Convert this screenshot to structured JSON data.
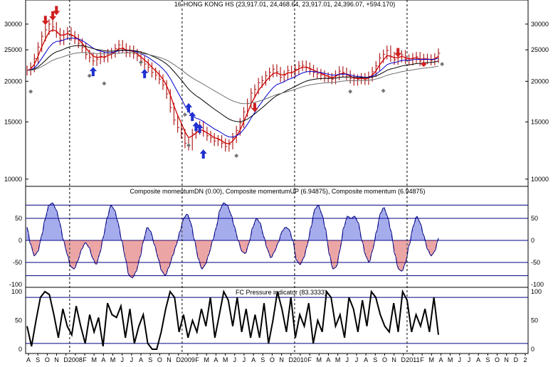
{
  "colors": {
    "up": "#1f2fd0",
    "down": "#d01f1f",
    "price_bar": "#b02020",
    "ma_fast": "#d00000",
    "ma_mid": "#0000d0",
    "ma_slow": "#000000",
    "ma_slowest": "#707070",
    "osc_line": "#000000",
    "band_line": "#000080",
    "grid": "#000000",
    "diamond": "#777777"
  },
  "icons": {
    "buy": "up-arrow-icon",
    "sell": "down-arrow-icon",
    "signal": "diamond-icon"
  },
  "chart_data": [
    {
      "type": "bar",
      "title": "16-HONG KONG HS (23,917.01, 24,468.64, 23,917.01, 24,396.07, +594.170)",
      "ylim": [
        9500,
        33500
      ],
      "scale": "log",
      "y_ticks": [
        "30000",
        "25000",
        "20000",
        "15000",
        "10000"
      ],
      "x_tick_labels": [
        "A",
        "S",
        "O",
        "N",
        "D",
        "2008",
        "F",
        "M",
        "A",
        "M",
        "J",
        "J",
        "A",
        "S",
        "O",
        "N",
        "D",
        "2009",
        "F",
        "M",
        "A",
        "M",
        "J",
        "J",
        "A",
        "S",
        "O",
        "N",
        "D",
        "2010",
        "F",
        "M",
        "A",
        "M",
        "J",
        "J",
        "A",
        "S",
        "O",
        "N",
        "D",
        "2011",
        "F",
        "M",
        "A",
        "M",
        "J",
        "J",
        "A",
        "S",
        "O",
        "N",
        "D",
        "2"
      ],
      "year_boundaries": [
        "2008",
        "2009",
        "2010",
        "2011"
      ],
      "closes": [
        21600,
        22100,
        23500,
        25500,
        27500,
        28800,
        30000,
        29400,
        28200,
        26800,
        27800,
        28400,
        27600,
        27000,
        26200,
        25400,
        24200,
        23700,
        23100,
        23400,
        23900,
        23700,
        24300,
        24500,
        25200,
        25900,
        25300,
        24600,
        24900,
        24300,
        23900,
        23100,
        22600,
        22100,
        21300,
        20900,
        20300,
        19500,
        18300,
        16600,
        15200,
        14400,
        13800,
        12900,
        12700,
        13800,
        14200,
        14600,
        14000,
        13600,
        13400,
        13100,
        13200,
        12900,
        12600,
        12800,
        13400,
        14100,
        14900,
        16100,
        17100,
        18400,
        18900,
        19800,
        20100,
        20800,
        21300,
        21800,
        21400,
        20600,
        20900,
        21600,
        21300,
        21800,
        22300,
        22400,
        22100,
        21700,
        21300,
        21100,
        20900,
        20600,
        20500,
        20300,
        20900,
        21500,
        21300,
        20900,
        20400,
        20100,
        20300,
        20500,
        20200,
        20700,
        21400,
        22300,
        23600,
        24200,
        24900,
        23800,
        23300,
        23700,
        24100,
        23400,
        23200,
        23600,
        23800,
        23100,
        23500,
        23400,
        23200,
        23600,
        24396
      ],
      "moving_averages": [
        "fast",
        "mid",
        "slow",
        "slowest"
      ],
      "sell_signals": [
        {
          "index": 5,
          "value": 30400
        },
        {
          "index": 7,
          "value": 31400
        },
        {
          "index": 8,
          "value": 32600
        },
        {
          "index": 62,
          "value": 16400
        },
        {
          "index": 101,
          "value": 24200
        }
      ],
      "buy_signals": [
        {
          "index": 18,
          "value": 21700
        },
        {
          "index": 32,
          "value": 21400
        },
        {
          "index": 44,
          "value": 16800
        },
        {
          "index": 45,
          "value": 15800
        },
        {
          "index": 46,
          "value": 14700
        },
        {
          "index": 47,
          "value": 14500
        },
        {
          "index": 48,
          "value": 12100
        }
      ],
      "diamonds": [
        {
          "index": 1,
          "value": 18600
        },
        {
          "index": 17,
          "value": 20800
        },
        {
          "index": 21,
          "value": 19700
        },
        {
          "index": 31,
          "value": 22900
        },
        {
          "index": 43,
          "value": 15800
        },
        {
          "index": 44,
          "value": 12700
        },
        {
          "index": 57,
          "value": 11800
        },
        {
          "index": 88,
          "value": 18600
        },
        {
          "index": 97,
          "value": 18700
        },
        {
          "index": 113,
          "value": 22600
        }
      ],
      "red_diamond": {
        "index": 108,
        "value": 22600
      }
    },
    {
      "type": "bar",
      "title": "Composite momentumDN (0.00), Composite momentumUP (6.94875), Composite momentum (6.94875)",
      "ylim": [
        -100,
        100
      ],
      "y_ticks": [
        "50",
        "0",
        "-50",
        "-100"
      ],
      "bands": [
        80,
        50,
        -50,
        -80
      ],
      "values": [
        30,
        -10,
        -35,
        -25,
        10,
        50,
        80,
        85,
        70,
        40,
        0,
        -30,
        -60,
        -65,
        -45,
        -20,
        -5,
        -15,
        -40,
        -55,
        -30,
        10,
        50,
        80,
        70,
        40,
        0,
        -40,
        -80,
        -85,
        -70,
        -40,
        0,
        30,
        20,
        -10,
        -40,
        -70,
        -80,
        -60,
        -35,
        -10,
        20,
        50,
        60,
        40,
        0,
        -40,
        -65,
        -55,
        -30,
        0,
        30,
        70,
        85,
        80,
        60,
        30,
        0,
        -25,
        -30,
        -5,
        30,
        50,
        40,
        10,
        -20,
        -40,
        -25,
        -5,
        20,
        30,
        25,
        0,
        -45,
        -55,
        -40,
        -10,
        30,
        70,
        80,
        60,
        25,
        -30,
        -65,
        -60,
        -20,
        30,
        55,
        50,
        55,
        40,
        0,
        -35,
        -50,
        -20,
        20,
        60,
        75,
        55,
        20,
        -30,
        -65,
        -70,
        -50,
        -10,
        30,
        55,
        40,
        10,
        -20,
        -35,
        -25,
        5
      ]
    },
    {
      "type": "line",
      "title": "FC Pressure indicator (83.3333)",
      "ylim": [
        0,
        100
      ],
      "y_ticks": [
        "100",
        "50",
        "0"
      ],
      "bands": [
        90,
        10
      ],
      "values": [
        40,
        5,
        50,
        90,
        100,
        95,
        60,
        20,
        70,
        40,
        25,
        75,
        40,
        10,
        60,
        30,
        55,
        5,
        80,
        60,
        55,
        75,
        20,
        70,
        10,
        40,
        60,
        10,
        0,
        0,
        30,
        70,
        100,
        90,
        30,
        60,
        20,
        50,
        30,
        70,
        40,
        90,
        20,
        60,
        100,
        85,
        40,
        90,
        30,
        70,
        20,
        60,
        20,
        80,
        10,
        50,
        100,
        70,
        30,
        90,
        20,
        60,
        40,
        80,
        10,
        50,
        30,
        100,
        90,
        40,
        60,
        20,
        90,
        70,
        30,
        85,
        40,
        100,
        90,
        60,
        40,
        30,
        80,
        30,
        100,
        85,
        30,
        60,
        40,
        70,
        30,
        90,
        25
      ]
    }
  ]
}
